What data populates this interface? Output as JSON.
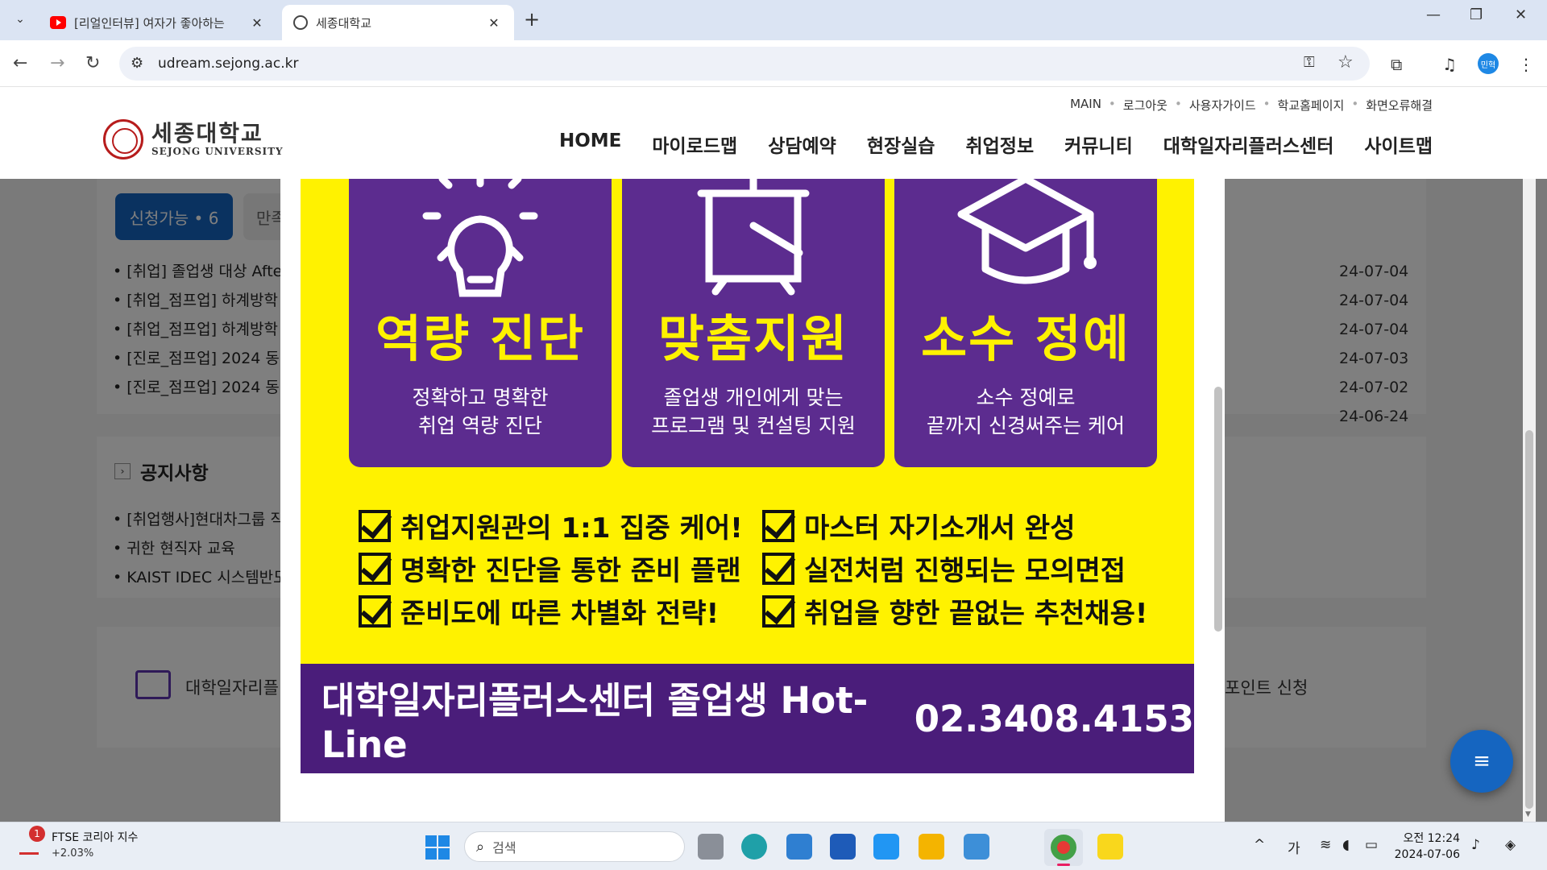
{
  "browser": {
    "tabs": [
      {
        "title": "[리얼인터뷰] 여자가 좋아하는",
        "active": false,
        "icon": "youtube-icon"
      },
      {
        "title": "세종대학교",
        "active": true,
        "icon": "globe-icon"
      }
    ],
    "url": "udream.sejong.ac.kr",
    "profile_label": "민혁"
  },
  "site": {
    "logo_ko": "세종대학교",
    "logo_en": "SEJONG UNIVERSITY",
    "util_links": [
      "MAIN",
      "로그아웃",
      "사용자가이드",
      "학교홈페이지",
      "화면오류해결"
    ],
    "nav": [
      "HOME",
      "마이로드맵",
      "상담예약",
      "현장실습",
      "취업정보",
      "커뮤니티",
      "대학일자리플러스센터",
      "사이트맵"
    ]
  },
  "background": {
    "pill_active": "신청가능 • 6",
    "pill_other": "만족",
    "program_list": [
      "[취업] 졸업생 대상 Afte",
      "[취업_점프업] 하계방학",
      "[취업_점프업] 하계방학",
      "[진로_점프업] 2024 동",
      "[진로_점프업] 2024 동"
    ],
    "dates": [
      "24-07-04",
      "24-07-04",
      "24-07-04",
      "24-07-03",
      "24-07-02",
      "24-06-24"
    ],
    "notice_title": "공지사항",
    "notice_list": [
      "[취업행사]현대차그룹 직",
      "귀한 현직자 교육",
      "KAIST IDEC 시스템반도"
    ],
    "bottom_left": "대학일자리플",
    "bottom_right": "포인트 신청"
  },
  "banner": {
    "boxes": [
      {
        "head": "역량 진단",
        "sub1": "정확하고 명확한",
        "sub2": "취업 역량 진단",
        "icon": "lightbulb-icon"
      },
      {
        "head": "맞춤지원",
        "sub1": "졸업생 개인에게 맞는",
        "sub2": "프로그램 및 컨설팅 지원",
        "icon": "presentation-board-icon"
      },
      {
        "head": "소수 정예",
        "sub1": "소수 정예로",
        "sub2": "끝까지 신경써주는 케어",
        "icon": "graduation-cap-icon"
      }
    ],
    "checks_left": [
      "취업지원관의 1:1 집중 케어!",
      "명확한 진단을 통한 준비 플랜",
      "준비도에 따른 차별화 전략!"
    ],
    "checks_right": [
      "마스터 자기소개서 완성",
      "실전처럼 진행되는 모의면접",
      "취업을 향한 끝없는 추천채용!"
    ],
    "hotline_label": "대학일자리플러스센터 졸업생 Hot-Line",
    "hotline_number": "02.3408.4153",
    "colors": {
      "yellow": "#fff200",
      "purple": "#5c2c8f",
      "dark_purple": "#4a1d7a"
    }
  },
  "taskbar": {
    "stock_name": "FTSE 코리아 지수",
    "stock_change": "+2.03%",
    "stock_badge": "1",
    "search_placeholder": "검색",
    "ime": "가",
    "time": "오전 12:24",
    "date": "2024-07-06"
  }
}
